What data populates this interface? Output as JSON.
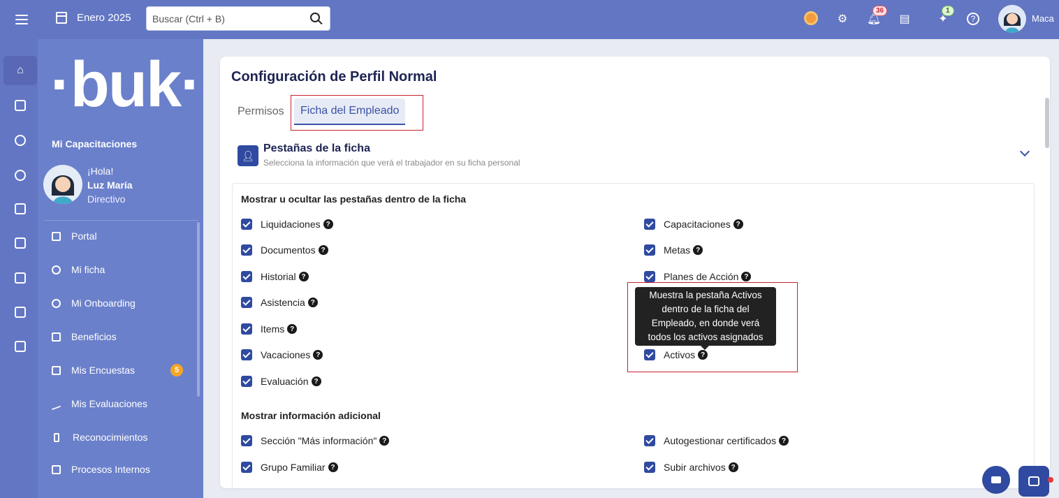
{
  "topbar": {
    "month": "Enero 2025",
    "search_placeholder": "Buscar (Ctrl + B)",
    "notifications_count": "36",
    "tasks_count": "1",
    "user_name": "Maca"
  },
  "sidebar": {
    "logo": "·buk·",
    "section_title": "Mi Capacitaciones",
    "greeting": "¡Hola!",
    "name": "Luz María",
    "role": "Directivo",
    "items": [
      {
        "label": "Portal"
      },
      {
        "label": "Mi ficha"
      },
      {
        "label": "Mi Onboarding"
      },
      {
        "label": "Beneficios"
      },
      {
        "label": "Mis Encuestas",
        "badge": "5"
      },
      {
        "label": "Mis Evaluaciones"
      },
      {
        "label": "Reconocimientos"
      },
      {
        "label": "Procesos Internos"
      }
    ]
  },
  "main": {
    "title": "Configuración de Perfil Normal",
    "tabs": [
      {
        "label": "Permisos"
      },
      {
        "label": "Ficha del Empleado"
      }
    ],
    "section": {
      "title": "Pestañas de la ficha",
      "subtitle": "Selecciona la información que verá el trabajador en su ficha personal"
    },
    "group1_title": "Mostrar u ocultar las pestañas dentro de la ficha",
    "group1_left": [
      "Liquidaciones",
      "Documentos",
      "Historial",
      "Asistencia",
      "Items",
      "Vacaciones",
      "Evaluación"
    ],
    "group1_right": [
      "Capacitaciones",
      "Metas",
      "Planes de Acción",
      "",
      "Activos"
    ],
    "tooltip": "Muestra la pestaña Activos dentro de la ficha del Empleado, en donde verá todos los activos asignados",
    "group2_title": "Mostrar información adicional",
    "group2_left": [
      "Sección \"Más información\"",
      "Grupo Familiar"
    ],
    "group2_right": [
      "Autogestionar certificados",
      "Subir archivos"
    ]
  },
  "colors": {
    "topbar": "#6376c4",
    "sidebar": "#6b80cb",
    "accent": "#2f4aa0",
    "highlight": "#c6202f"
  }
}
